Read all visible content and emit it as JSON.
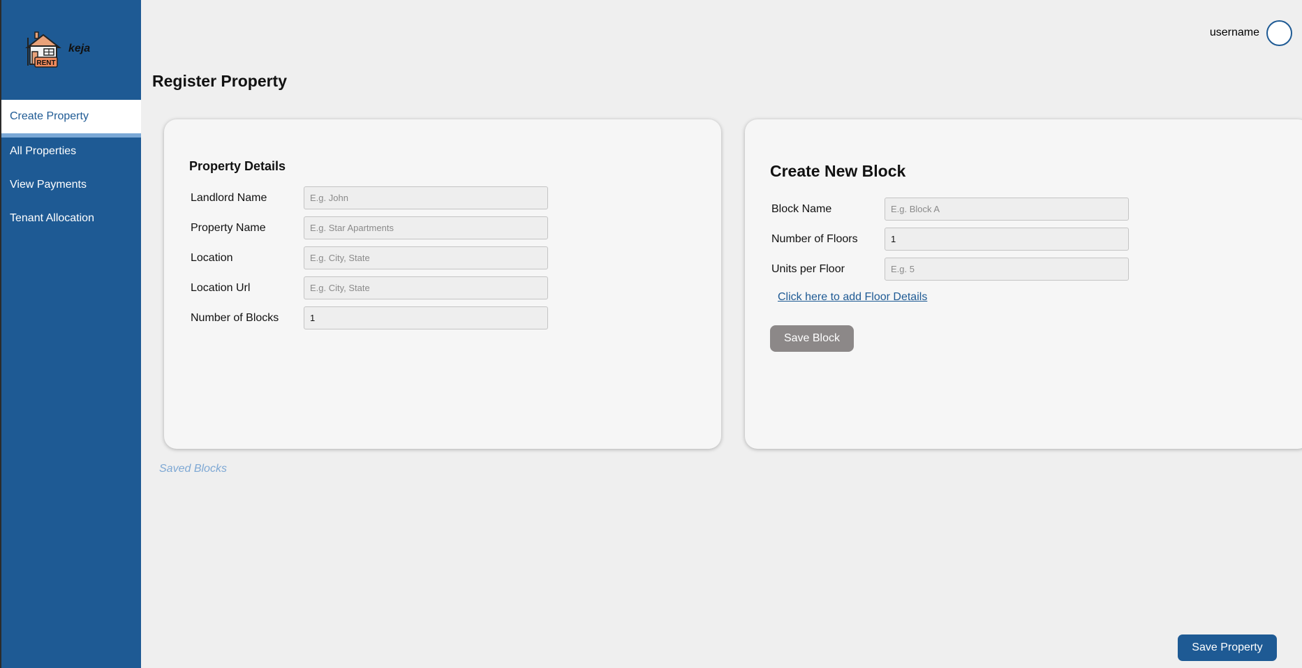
{
  "brand": {
    "name": "keja",
    "logo_badge": "RENT"
  },
  "sidebar": {
    "items": [
      {
        "label": "Create Property",
        "active": true
      },
      {
        "label": "All Properties"
      },
      {
        "label": "View Payments"
      },
      {
        "label": "Tenant Allocation"
      }
    ]
  },
  "user": {
    "name": "username"
  },
  "page": {
    "title": "Register Property"
  },
  "property": {
    "title": "Property Details",
    "fields": [
      {
        "label": "Landlord Name",
        "placeholder": "E.g. John",
        "value": ""
      },
      {
        "label": "Property Name",
        "placeholder": "E.g. Star Apartments",
        "value": ""
      },
      {
        "label": "Location",
        "placeholder": "E.g. City, State",
        "value": ""
      },
      {
        "label": "Location Url",
        "placeholder": "E.g. City, State",
        "value": ""
      },
      {
        "label": "Number of Blocks",
        "placeholder": "",
        "value": "1"
      }
    ]
  },
  "block": {
    "title": "Create New Block",
    "fields": [
      {
        "label": "Block Name",
        "placeholder": "E.g. Block A",
        "value": ""
      },
      {
        "label": "Number of Floors",
        "placeholder": "",
        "value": "1"
      },
      {
        "label": "Units per Floor",
        "placeholder": "E.g. 5",
        "value": ""
      }
    ],
    "floor_link": "Click here to add Floor Details",
    "save_label": "Save Block"
  },
  "saved_blocks_label": "Saved Blocks",
  "save_property_label": "Save Property",
  "colors": {
    "primary": "#1e5a94",
    "background": "#efefef",
    "card": "#f6f6f6",
    "muted_button": "#8c8888",
    "accent_light": "#7ea8d4"
  }
}
